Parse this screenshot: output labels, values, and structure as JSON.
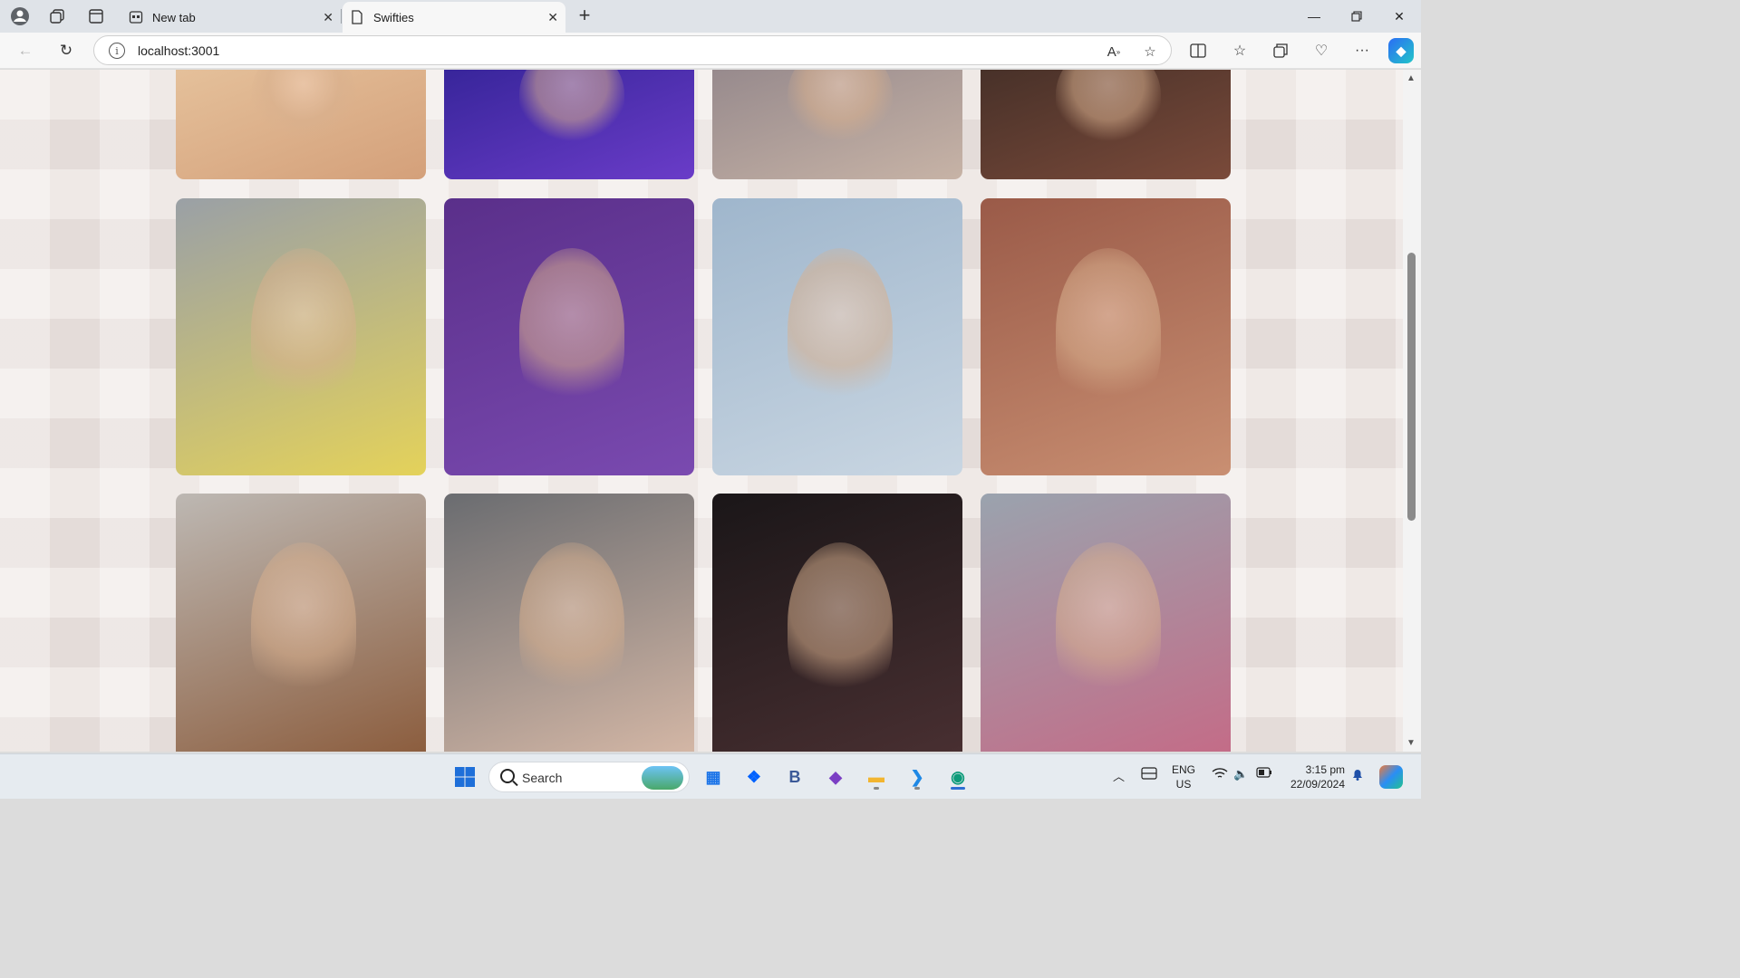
{
  "browser": {
    "tabs": [
      {
        "title": "New tab",
        "active": false
      },
      {
        "title": "Swifties",
        "active": true
      }
    ],
    "address": "localhost:3001"
  },
  "gallery": {
    "columns": 4,
    "rows": [
      {
        "partial": true,
        "photos": [
          {
            "alt": "photo-1",
            "colors": [
              "#e9c9a3",
              "#d4a07a"
            ]
          },
          {
            "alt": "photo-2",
            "colors": [
              "#2a1f8e",
              "#6a3cc8"
            ]
          },
          {
            "alt": "photo-3",
            "colors": [
              "#8a7f86",
              "#c7b3a6"
            ]
          },
          {
            "alt": "photo-4",
            "colors": [
              "#3a2a24",
              "#7a4a3a"
            ]
          }
        ]
      },
      {
        "partial": false,
        "photos": [
          {
            "alt": "photo-5",
            "colors": [
              "#9aa0a6",
              "#e4d25a"
            ]
          },
          {
            "alt": "photo-6",
            "colors": [
              "#5a2f8a",
              "#7a4ab0"
            ]
          },
          {
            "alt": "photo-7",
            "colors": [
              "#9fb6cc",
              "#c9d6e2"
            ]
          },
          {
            "alt": "photo-8",
            "colors": [
              "#9a5a48",
              "#c98f72"
            ]
          }
        ]
      },
      {
        "partial": true,
        "photos": [
          {
            "alt": "photo-9",
            "colors": [
              "#bdb8b3",
              "#8a5a3a"
            ]
          },
          {
            "alt": "photo-10",
            "colors": [
              "#6a6c70",
              "#d7b9a7"
            ]
          },
          {
            "alt": "photo-11",
            "colors": [
              "#1a1618",
              "#4a3032"
            ]
          },
          {
            "alt": "photo-12",
            "colors": [
              "#9aa3ae",
              "#c56a86"
            ]
          }
        ]
      }
    ]
  },
  "taskbar": {
    "search_label": "Search",
    "lang_top": "ENG",
    "lang_bottom": "US",
    "time": "3:15 pm",
    "date": "22/09/2024",
    "pinned": [
      {
        "name": "microsoft-store-icon",
        "glyph": "▦",
        "color": "#1a73e8"
      },
      {
        "name": "dropbox-icon",
        "glyph": "❖",
        "color": "#0061fe"
      },
      {
        "name": "b-app-icon",
        "glyph": "B",
        "color": "#3b5998"
      },
      {
        "name": "visual-studio-icon",
        "glyph": "◆",
        "color": "#7b3fc4"
      },
      {
        "name": "file-explorer-icon",
        "glyph": "▬",
        "color": "#f2b530"
      },
      {
        "name": "vscode-icon",
        "glyph": "❯",
        "color": "#1e88e5"
      },
      {
        "name": "edge-icon",
        "glyph": "◉",
        "color": "#0d9b7a"
      }
    ]
  }
}
